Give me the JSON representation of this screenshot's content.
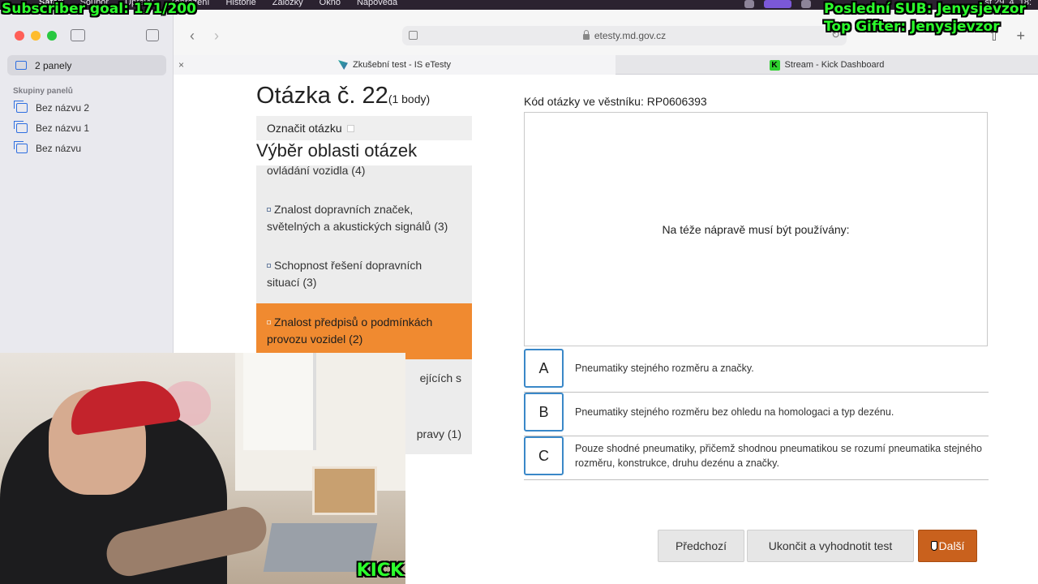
{
  "menubar": {
    "items": [
      "Safari",
      "Soubor",
      "Úpravy",
      "Zobrazení",
      "Historie",
      "Záložky",
      "Okno",
      "Nápověda"
    ],
    "clock": "st 29. 4. 18:"
  },
  "overlays": {
    "subscriber_goal": "Subscriber goal: 171/200",
    "last_sub": "Poslední SUB: Jenysjevzor",
    "top_gifter": "Top Gifter: Jenysjevzor",
    "kick_logo": "KICK"
  },
  "sidebar": {
    "panels_label": "2 panely",
    "groups_title": "Skupiny panelů",
    "groups": [
      "Bez názvu 2",
      "Bez názvu 1",
      "Bez názvu"
    ]
  },
  "toolbar": {
    "url": "etesty.md.gov.cz"
  },
  "tabs": [
    {
      "title": "Zkušební test - IS eTesty",
      "active": true
    },
    {
      "title": "Stream - Kick Dashboard",
      "active": false
    }
  ],
  "question": {
    "title": "Otázka č. 22",
    "points": "(1 body)",
    "mark_label": "Označit otázku",
    "code_label": "Kód otázky ve věstníku: RP0606393",
    "text": "Na téže nápravě musí být používány:"
  },
  "areas": {
    "title": "Výběr oblasti otázek",
    "items": [
      {
        "line1": "ovládání vozidla (4)",
        "line2": "",
        "bullet": false,
        "active": false
      },
      {
        "line1": "Znalost dopravních značek,",
        "line2": "světelných a akustických signálů (3)",
        "bullet": true,
        "active": false
      },
      {
        "line1": "Schopnost řešení dopravních",
        "line2": "situací (3)",
        "bullet": true,
        "active": false
      },
      {
        "line1": "Znalost předpisů o podmínkách",
        "line2": "provozu vozidel (2)",
        "bullet": true,
        "active": true
      },
      {
        "line1": "ejících s",
        "line2": "",
        "bullet": false,
        "active": false
      },
      {
        "line1": "pravy (1)",
        "line2": "",
        "bullet": false,
        "active": false
      }
    ]
  },
  "answers": [
    {
      "letter": "A",
      "text": "Pneumatiky stejného rozměru a značky."
    },
    {
      "letter": "B",
      "text": "Pneumatiky stejného rozměru bez ohledu na homologaci a typ dezénu."
    },
    {
      "letter": "C",
      "text": "Pouze shodné pneumatiky, přičemž shodnou pneumatikou se rozumí pneumatika stejného rozměru, konstrukce, druhu dezénu a značky."
    }
  ],
  "buttons": {
    "prev": "Předchozí",
    "finish": "Ukončit a vyhodnotit test",
    "next": "Další"
  },
  "colors": {
    "accent_orange": "#f08a30",
    "next_button": "#c9611d",
    "answer_border": "#3a88c8",
    "overlay_green": "#2cff2c"
  }
}
